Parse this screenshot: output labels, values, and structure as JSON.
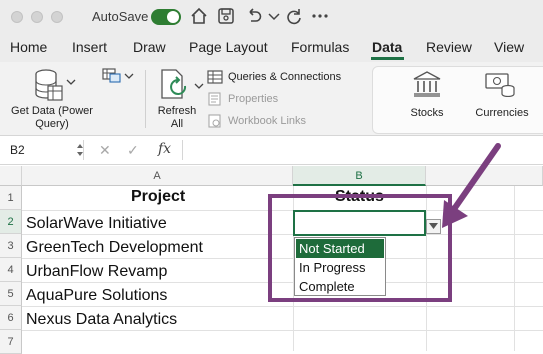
{
  "titlebar": {
    "autosave_label": "AutoSave",
    "autosave_on": true
  },
  "ribbon_tabs": [
    "Home",
    "Insert",
    "Draw",
    "Page Layout",
    "Formulas",
    "Data",
    "Review",
    "View"
  ],
  "ribbon": {
    "get_data_line1": "Get Data (Power",
    "get_data_line2": "Query)",
    "refresh_line1": "Refresh",
    "refresh_line2": "All",
    "queries_connections": "Queries & Connections",
    "properties": "Properties",
    "workbook_links": "Workbook Links",
    "stocks": "Stocks",
    "currencies": "Currencies"
  },
  "formula_bar": {
    "name_box": "B2",
    "fx": "fx",
    "formula": ""
  },
  "columns": [
    "A",
    "B"
  ],
  "rows": [
    "1",
    "2",
    "3",
    "4",
    "5",
    "6",
    "7"
  ],
  "sheet": {
    "header_project": "Project",
    "header_status": "Status",
    "projects": [
      "SolarWave Initiative",
      "GreenTech Development",
      "UrbanFlow Revamp",
      "AquaPure Solutions",
      "Nexus Data Analytics"
    ]
  },
  "dropdown": {
    "options": [
      "Not Started",
      "In Progress",
      "Complete"
    ],
    "highlighted_index": 0
  },
  "colors": {
    "accent": "#1e7145",
    "callout": "#7b3f7f",
    "highlight": "#1e6b3a"
  }
}
